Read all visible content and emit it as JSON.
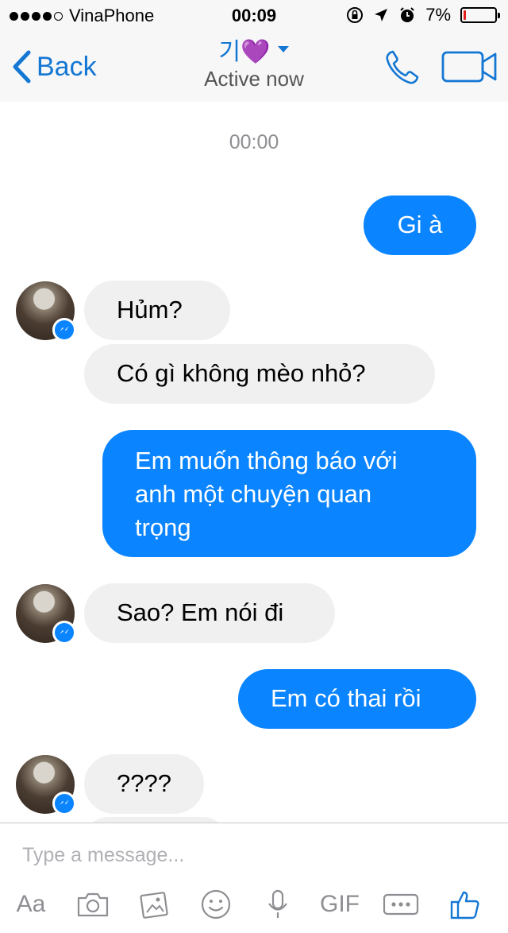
{
  "status_bar": {
    "carrier": "VinaPhone",
    "time": "00:09",
    "battery_percent": "7%",
    "battery_level": 0.07,
    "icons": [
      "signal-dots-icon",
      "rotation-lock-icon",
      "location-arrow-icon",
      "alarm-icon",
      "battery-icon"
    ]
  },
  "nav": {
    "back_label": "Back",
    "contact_name": "기💜",
    "status": "Active now",
    "icons": [
      "back-chevron-icon",
      "dropdown-caret-icon",
      "phone-icon",
      "video-camera-icon"
    ]
  },
  "conversation": {
    "timestamp": "00:00",
    "messages": [
      {
        "direction": "out",
        "text": "Gi à"
      },
      {
        "direction": "in",
        "text": "Hủm?"
      },
      {
        "direction": "in",
        "text": "Có gì không mèo nhỏ?"
      },
      {
        "direction": "out",
        "lines": [
          "Em muốn thông báo với",
          "anh một chuyện quan",
          "trọng"
        ]
      },
      {
        "direction": "in",
        "text": "Sao? Em nói đi"
      },
      {
        "direction": "out",
        "text": "Em có thai rồi"
      },
      {
        "direction": "in",
        "text": "????"
      }
    ]
  },
  "composer": {
    "placeholder": "Type a message...",
    "aa_label": "Aa",
    "gif_label": "GIF",
    "icons": [
      "camera-icon",
      "photo-gallery-icon",
      "emoji-icon",
      "microphone-icon",
      "more-options-icon",
      "thumbs-up-icon"
    ]
  },
  "colors": {
    "accent": "#1477d4",
    "outgoing_bubble": "#0a84ff",
    "incoming_bubble": "#f0f0f0",
    "header_bg": "#f7f7f7",
    "muted": "#8e8e93",
    "battery_low": "#e0201b"
  }
}
